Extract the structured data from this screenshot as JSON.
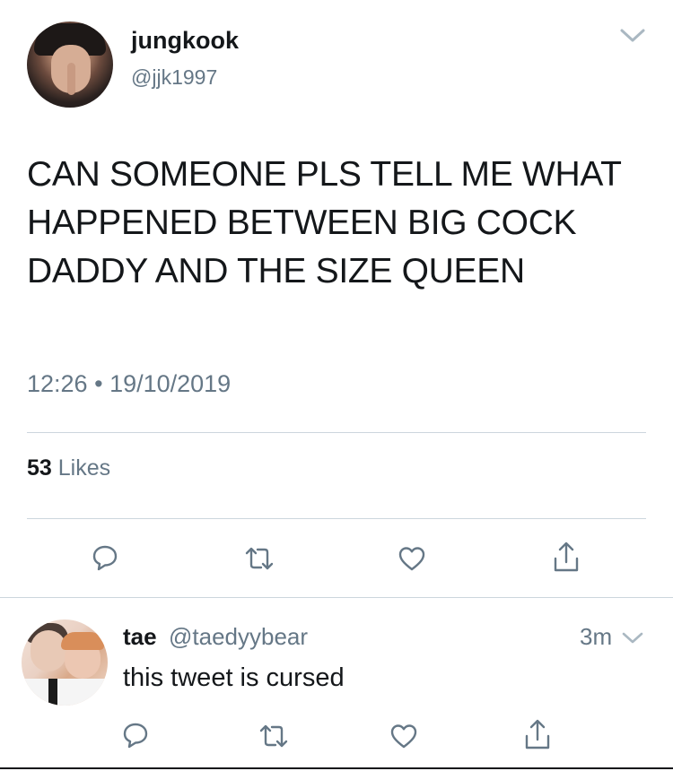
{
  "tweet": {
    "display_name": "jungkook",
    "handle": "@jjk1997",
    "text": "CAN SOMEONE PLS TELL ME WHAT HAPPENED BETWEEN BIG COCK DADDY AND THE SIZE QUEEN",
    "time": "12:26",
    "separator": "•",
    "date": "19/10/2019",
    "likes_count": "53",
    "likes_label": "Likes",
    "icons": [
      "chevron-down-icon",
      "reply-icon",
      "retweet-icon",
      "like-icon",
      "share-icon"
    ]
  },
  "reply": {
    "display_name": "tae",
    "handle": "@taedyybear",
    "age": "3m",
    "text": "this tweet is cursed",
    "icons": [
      "chevron-down-icon",
      "reply-icon",
      "retweet-icon",
      "like-icon",
      "share-icon"
    ]
  },
  "colors": {
    "text_primary": "#14171a",
    "text_secondary": "#657786",
    "divider": "#ccd6dd"
  }
}
